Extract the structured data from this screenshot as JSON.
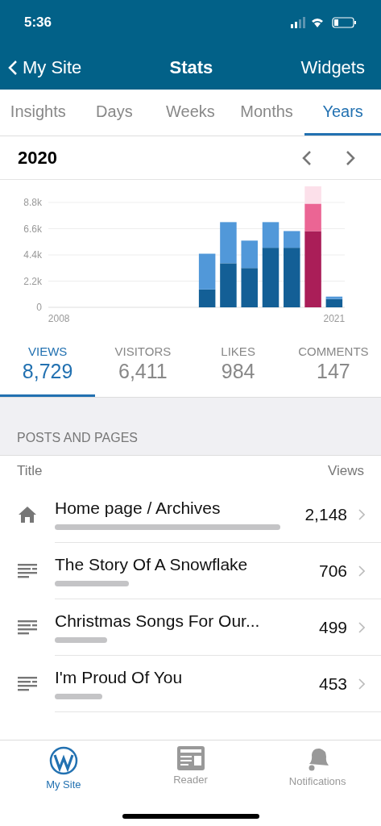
{
  "status_bar": {
    "time": "5:36"
  },
  "nav": {
    "back": "My Site",
    "title": "Stats",
    "action": "Widgets"
  },
  "period_tabs": [
    {
      "label": "Insights",
      "selected": false
    },
    {
      "label": "Days",
      "selected": false
    },
    {
      "label": "Weeks",
      "selected": false
    },
    {
      "label": "Months",
      "selected": false
    },
    {
      "label": "Years",
      "selected": true
    }
  ],
  "period": {
    "label": "2020",
    "chart_data": {
      "type": "bar",
      "stacked": true,
      "grid": true,
      "x": [
        2015,
        2016,
        2017,
        2018,
        2019,
        2020,
        2021
      ],
      "series": [
        {
          "color": "#135f96",
          "values": [
            1500,
            3700,
            3300,
            5000,
            5000,
            null,
            700
          ]
        },
        {
          "color": "#aa1e58",
          "values": [
            null,
            null,
            null,
            null,
            null,
            6400,
            null
          ]
        },
        {
          "color": "#5198d9",
          "values": [
            3000,
            3450,
            2300,
            2150,
            1400,
            null,
            200
          ]
        },
        {
          "color": "#eb6594",
          "values": [
            null,
            null,
            null,
            null,
            null,
            2300,
            null
          ]
        }
      ],
      "xlim": [
        2007.5,
        2021.5
      ],
      "ylim": [
        0,
        8800
      ],
      "xticks": [
        2008,
        2021
      ],
      "yticks": [
        0,
        {
          "value": 2200,
          "label": "2.2k"
        },
        {
          "value": 4400,
          "label": "4.4k"
        },
        {
          "value": 6600,
          "label": "6.6k"
        },
        {
          "value": 8800,
          "label": "8.8k"
        }
      ]
    }
  },
  "summary": [
    {
      "label": "VIEWS",
      "value": "8,729",
      "selected": true
    },
    {
      "label": "VISITORS",
      "value": "6,411",
      "selected": false
    },
    {
      "label": "LIKES",
      "value": "984",
      "selected": false
    },
    {
      "label": "COMMENTS",
      "value": "147",
      "selected": false
    }
  ],
  "posts": {
    "heading": "POSTS AND PAGES",
    "column_title": "Title",
    "column_views": "Views",
    "rows": [
      {
        "kind": "home",
        "title": "Home page / Archives",
        "views": "2,148"
      },
      {
        "kind": "page",
        "title": "The Story Of A Snowflake",
        "views": "706"
      },
      {
        "kind": "page",
        "title": "Christmas Songs For Our...",
        "views": "499"
      },
      {
        "kind": "page",
        "title": "I'm Proud Of You",
        "views": "453"
      }
    ]
  },
  "tab_bar": [
    {
      "label": "My Site",
      "selected": true
    },
    {
      "label": "Reader",
      "selected": false
    },
    {
      "label": "Notifications",
      "selected": false
    }
  ]
}
